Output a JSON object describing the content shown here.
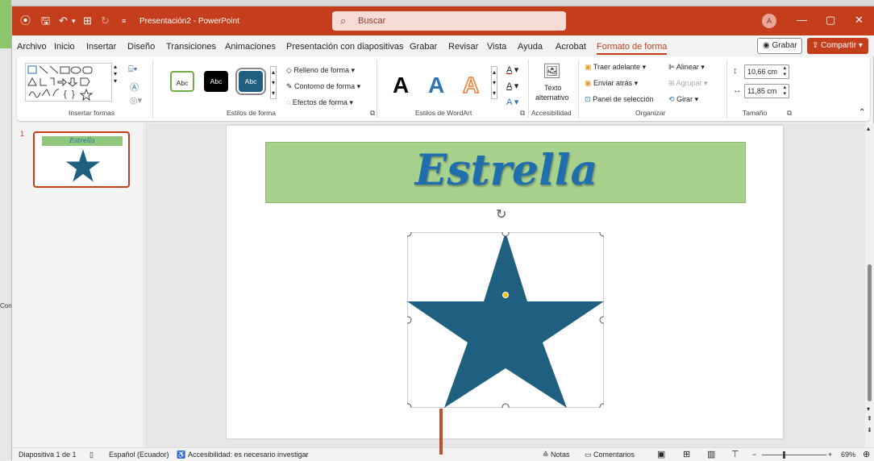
{
  "titlebar": {
    "doc_title": "Presentación2 - PowerPoint",
    "search_placeholder": "Buscar",
    "avatar_initial": "A",
    "accent": "#c43e1c"
  },
  "menu": {
    "tabs": [
      "Archivo",
      "Inicio",
      "Insertar",
      "Diseño",
      "Transiciones",
      "Animaciones",
      "Presentación con diapositivas",
      "Grabar",
      "Revisar",
      "Vista",
      "Ayuda",
      "Acrobat",
      "Formato de forma"
    ],
    "active": "Formato de forma",
    "grabar": "Grabar",
    "compartir": "Compartir"
  },
  "ribbon": {
    "groups": {
      "insertar_formas": "Insertar formas",
      "estilos_forma": "Estilos de forma",
      "estilos_wordart": "Estilos de WordArt",
      "accesibilidad": "Accesibilidad",
      "organizar": "Organizar",
      "tamano": "Tamaño"
    },
    "style_abc": [
      "Abc",
      "Abc",
      "Abc"
    ],
    "relleno": "Relleno de forma",
    "contorno": "Contorno de forma",
    "efectos": "Efectos de forma",
    "wordart": [
      "A",
      "A",
      "A"
    ],
    "texto_alt_1": "Texto",
    "texto_alt_2": "alternativo",
    "traer": "Traer adelante",
    "enviar": "Enviar atrás",
    "panel": "Panel de selección",
    "alinear": "Alinear",
    "agrupar": "Agrupar",
    "girar": "Girar",
    "alto": "10,66 cm",
    "ancho": "11,85 cm"
  },
  "thumbs": {
    "number": "1",
    "title": "Estrella"
  },
  "slide": {
    "title": "Estrella",
    "star_color": "#1f5f7f",
    "title_fill": "#a9d18e",
    "title_color": "#1f6fae"
  },
  "status": {
    "slide_count": "Diapositiva 1 de 1",
    "language": "Español (Ecuador)",
    "accessibility": "Accesibilidad: es necesario investigar",
    "notas": "Notas",
    "comentarios": "Comentarios",
    "zoom": "69%"
  },
  "left_fragment": "Con"
}
